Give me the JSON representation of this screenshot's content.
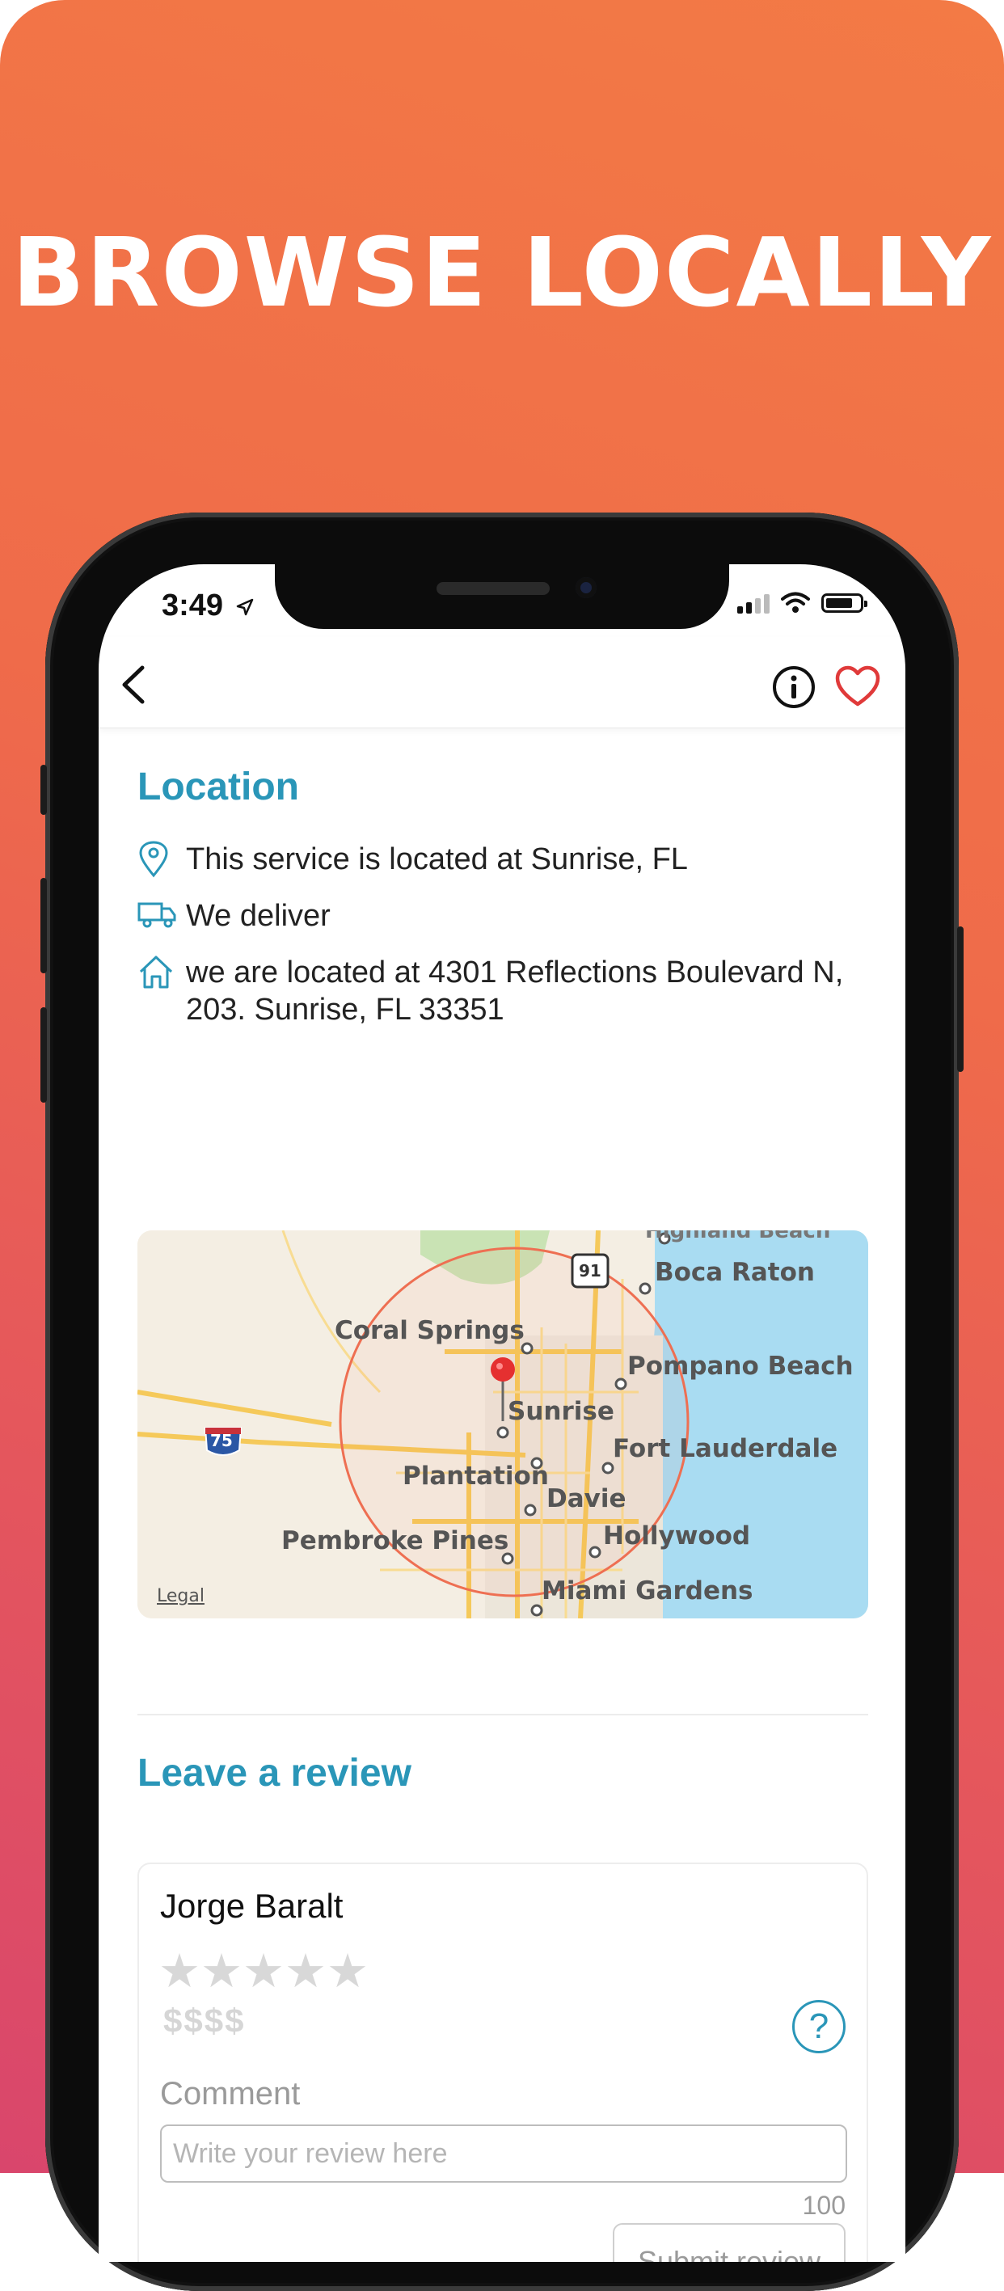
{
  "headline": "BROWSE LOCALLY",
  "status_bar": {
    "time": "3:49"
  },
  "nav": {
    "back_icon": "chevron-left-icon",
    "info_icon": "info-circle-icon",
    "favorite_icon": "heart-outline-icon"
  },
  "location": {
    "title": "Location",
    "rows": [
      {
        "icon": "map-pin-icon",
        "text": "This service is located at Sunrise, FL"
      },
      {
        "icon": "delivery-truck-icon",
        "text": "We deliver"
      },
      {
        "icon": "home-icon",
        "text": "we are located at 4301 Reflections Boulevard N, 203. Sunrise, FL 33351"
      }
    ],
    "map": {
      "labels": {
        "highland_beach": "Highland Beach",
        "boca_raton": "Boca Raton",
        "coral_springs": "Coral Springs",
        "pompano_beach": "Pompano Beach",
        "sunrise": "Sunrise",
        "fort_lauderdale": "Fort Lauderdale",
        "plantation": "Plantation",
        "davie": "Davie",
        "pembroke_pines": "Pembroke Pines",
        "hollywood": "Hollywood",
        "miami_gardens": "Miami Gardens",
        "legal": "Legal",
        "interstate": "75",
        "state_road": "91"
      }
    }
  },
  "review": {
    "title": "Leave a review",
    "reviewer": "Jorge Baralt",
    "stars": "★★★★★",
    "price_level": "$$$$",
    "help_label": "?",
    "comment_label": "Comment",
    "comment_placeholder": "Write your review here",
    "comment_value": "",
    "char_limit": "100",
    "submit_label": "Submit review"
  },
  "colors": {
    "accent": "#2a96b8",
    "favorite": "#e03a3a",
    "gradient_top": "#f37a45",
    "gradient_bottom": "#d9466c"
  }
}
